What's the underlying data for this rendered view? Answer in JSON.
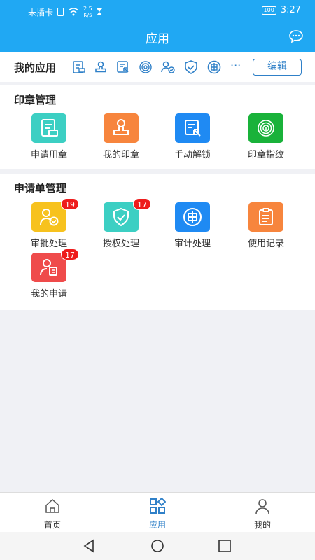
{
  "status": {
    "carrier": "未插卡",
    "speed_value": "2.5",
    "speed_unit": "K/s",
    "battery": "100",
    "time": "3:27"
  },
  "header": {
    "title": "应用"
  },
  "my_apps": {
    "label": "我的应用",
    "more": "···",
    "edit": "编辑"
  },
  "seal_section": {
    "title": "印章管理",
    "items": [
      {
        "label": "申请用章",
        "icon": "apply-seal-icon",
        "color": "#3ccfc3"
      },
      {
        "label": "我的印章",
        "icon": "my-seal-icon",
        "color": "#f7853d"
      },
      {
        "label": "手动解锁",
        "icon": "manual-unlock-icon",
        "color": "#1f8af3"
      },
      {
        "label": "印章指纹",
        "icon": "fingerprint-icon",
        "color": "#19b23a"
      }
    ]
  },
  "form_section": {
    "title": "申请单管理",
    "items": [
      {
        "label": "审批处理",
        "icon": "approval-icon",
        "color": "#f7c21e",
        "badge": "19"
      },
      {
        "label": "授权处理",
        "icon": "authorize-shield-icon",
        "color": "#3ccfc3",
        "badge": "17"
      },
      {
        "label": "审计处理",
        "icon": "audit-icon",
        "color": "#1f8af3"
      },
      {
        "label": "使用记录",
        "icon": "usage-record-icon",
        "color": "#f7853d"
      },
      {
        "label": "我的申请",
        "icon": "my-application-icon",
        "color": "#ef4b4b",
        "badge": "17"
      }
    ]
  },
  "tabs": [
    {
      "label": "首页",
      "icon": "home-icon"
    },
    {
      "label": "应用",
      "icon": "apps-grid-icon",
      "active": true
    },
    {
      "label": "我的",
      "icon": "profile-icon"
    }
  ],
  "colors": {
    "primary": "#20a8f3",
    "accent": "#2f80c8",
    "badge": "#ee1c1c"
  }
}
